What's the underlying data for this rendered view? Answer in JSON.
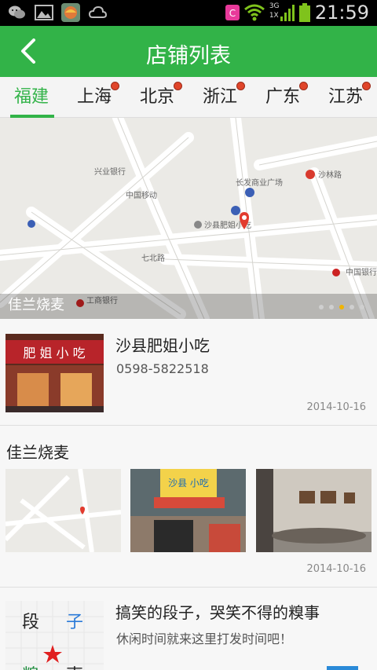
{
  "status_bar": {
    "time": "21:59",
    "network": "3G",
    "network2": "1X",
    "icons": [
      "wechat-icon",
      "gallery-icon",
      "app-icon",
      "weather-icon",
      "notification-icon",
      "wifi-icon",
      "signal-icon",
      "battery-icon"
    ]
  },
  "header": {
    "title": "店铺列表"
  },
  "tabs": [
    {
      "label": "福建",
      "active": true
    },
    {
      "label": "上海"
    },
    {
      "label": "北京"
    },
    {
      "label": "浙江"
    },
    {
      "label": "广东"
    },
    {
      "label": "江苏"
    }
  ],
  "banner": {
    "caption": "佳兰烧麦",
    "map_labels": {
      "l1": "沙县肥姐小吃",
      "l2": "长发商业广场",
      "l3": "沙林路",
      "l4": "中国银行",
      "l5": "兴业银行",
      "l6": "中国移动",
      "l7": "七北路",
      "l8": "工商银行"
    },
    "active_dot": 2,
    "dot_count": 5
  },
  "items": [
    {
      "title": "沙县肥姐小吃",
      "phone": "0598-5822518",
      "date": "2014-10-16",
      "sign": "肥 姐 小 吃"
    },
    {
      "title": "佳兰烧麦",
      "date": "2014-10-16",
      "photo_sign": "沙县 小吃"
    },
    {
      "title": "搞笑的段子，哭笑不得的糗事",
      "desc": "休闲时间就来这里打发时间吧！",
      "char1": "段",
      "char2": "子",
      "char3": "糗",
      "char4": "事"
    }
  ],
  "colors": {
    "brand": "#32b348",
    "badge": "#e0452a",
    "dot_active": "#f0b400"
  }
}
